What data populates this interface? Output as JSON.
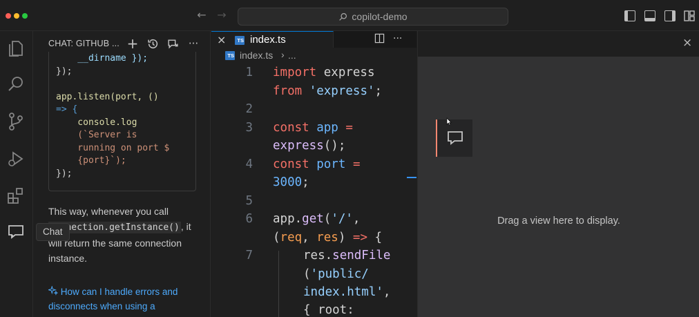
{
  "window": {
    "command_center": "copilot-demo"
  },
  "activity_bar": {
    "tooltip": "Chat"
  },
  "chat": {
    "title": "CHAT: GITHUB ...",
    "code_lines": [
      "    __dirname });",
      "});",
      "",
      "app.listen(port, ()",
      "=> {",
      "    console.log",
      "    (`Server is",
      "    running on port $",
      "    {port}`);",
      "});"
    ],
    "answer_prefix": "This way, whenever you call",
    "answer_code": "Connection.getInstance()",
    "answer_suffix": ", it will return the same connection instance.",
    "followup": "How can I handle errors and disconnects when using a"
  },
  "editor": {
    "tab_label": "index.ts",
    "tab_badge": "TS",
    "breadcrumb_file": "index.ts",
    "breadcrumb_sep": "›",
    "breadcrumb_more": "...",
    "line_numbers": [
      "1",
      "2",
      "3",
      "4",
      "5",
      "6",
      "7"
    ]
  },
  "aux_panel": {
    "empty_message": "Drag a view here to display."
  },
  "colors": {
    "accent": "#0078d4",
    "drag_indicator": "#f48771",
    "link": "#4daafc"
  }
}
